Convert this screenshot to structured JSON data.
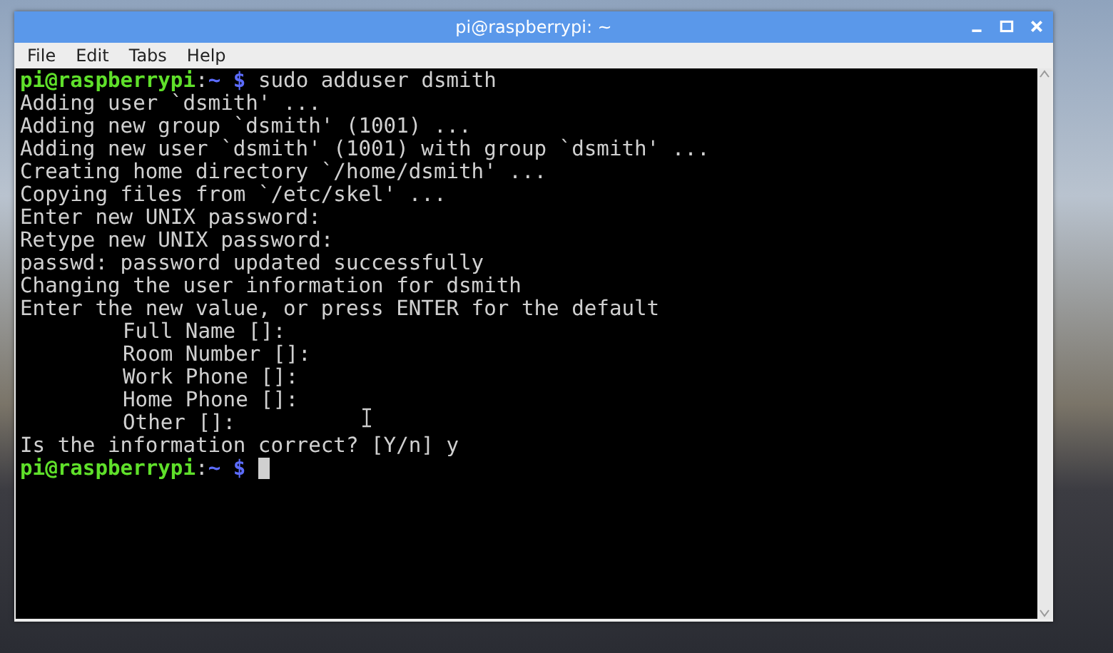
{
  "window": {
    "title": "pi@raspberrypi: ~"
  },
  "menu": [
    {
      "label": "File"
    },
    {
      "label": "Edit"
    },
    {
      "label": "Tabs"
    },
    {
      "label": "Help"
    }
  ],
  "terminal": {
    "lines": [
      {
        "kind": "prompt",
        "user_host": "pi@raspberrypi",
        "separator": ":",
        "path": "~",
        "symbol": "$",
        "command": "sudo adduser dsmith",
        "cursor": false
      },
      {
        "kind": "output",
        "text": "Adding user `dsmith' ..."
      },
      {
        "kind": "output",
        "text": "Adding new group `dsmith' (1001) ..."
      },
      {
        "kind": "output",
        "text": "Adding new user `dsmith' (1001) with group `dsmith' ..."
      },
      {
        "kind": "output",
        "text": "Creating home directory `/home/dsmith' ..."
      },
      {
        "kind": "output",
        "text": "Copying files from `/etc/skel' ..."
      },
      {
        "kind": "output",
        "text": "Enter new UNIX password:"
      },
      {
        "kind": "output",
        "text": "Retype new UNIX password:"
      },
      {
        "kind": "output",
        "text": "passwd: password updated successfully"
      },
      {
        "kind": "output",
        "text": "Changing the user information for dsmith"
      },
      {
        "kind": "output",
        "text": "Enter the new value, or press ENTER for the default"
      },
      {
        "kind": "field",
        "text": "Full Name []:"
      },
      {
        "kind": "field",
        "text": "Room Number []:"
      },
      {
        "kind": "field",
        "text": "Work Phone []:"
      },
      {
        "kind": "field",
        "text": "Home Phone []:"
      },
      {
        "kind": "field",
        "text": "Other []:"
      },
      {
        "kind": "output",
        "text": "Is the information correct? [Y/n] y"
      },
      {
        "kind": "prompt",
        "user_host": "pi@raspberrypi",
        "separator": ":",
        "path": "~",
        "symbol": "$",
        "cursor": true
      }
    ]
  }
}
